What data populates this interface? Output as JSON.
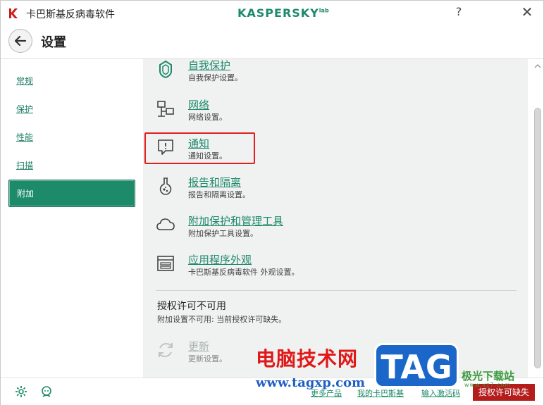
{
  "window": {
    "app_title": "卡巴斯基反病毒软件",
    "brand": "KASPERSKY",
    "brand_sub": "lab",
    "help_glyph": "?",
    "close_glyph": "✕"
  },
  "header": {
    "title": "设置"
  },
  "sidebar": {
    "items": [
      {
        "label": "常规",
        "active": false
      },
      {
        "label": "保护",
        "active": false
      },
      {
        "label": "性能",
        "active": false
      },
      {
        "label": "扫描",
        "active": false
      },
      {
        "label": "附加",
        "active": true
      }
    ]
  },
  "content": {
    "sections": [
      {
        "title": "自我保护",
        "desc": "自我保护设置。",
        "icon": "shield-icon"
      },
      {
        "title": "网络",
        "desc": "网络设置。",
        "icon": "network-icon"
      },
      {
        "title": "通知",
        "desc": "通知设置。",
        "icon": "notification-icon"
      },
      {
        "title": "报告和隔离",
        "desc": "报告和隔离设置。",
        "icon": "flask-icon"
      },
      {
        "title": "附加保护和管理工具",
        "desc": "附加保护工具设置。",
        "icon": "cloud-icon"
      },
      {
        "title": "应用程序外观",
        "desc": "卡巴斯基反病毒软件 外观设置。",
        "icon": "appearance-icon"
      }
    ],
    "license": {
      "title": "授权许可不可用",
      "desc": "附加设置不可用: 当前授权许可缺失。"
    },
    "update": {
      "title": "更新",
      "desc": "更新设置。",
      "icon": "refresh-icon"
    }
  },
  "footer": {
    "links": [
      "更多产品",
      "我的卡巴斯基",
      "输入激活码"
    ],
    "license_button": "授权许可缺失"
  },
  "watermark": {
    "text": "电脑技术网",
    "url": "www.tagxp.com",
    "badge": "TAG",
    "site": "极光下载站",
    "site_en": "www.xz7.com"
  },
  "colors": {
    "accent": "#1d8a6a",
    "highlight": "#e02020",
    "license_button": "#b51c1c"
  }
}
